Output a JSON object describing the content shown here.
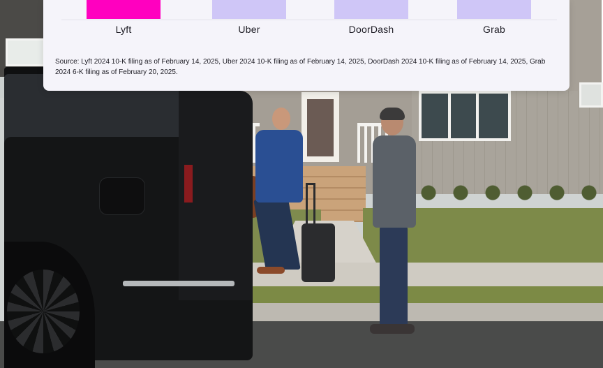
{
  "chart": {
    "categories": [
      {
        "label": "Lyft",
        "color": "#ff00bf"
      },
      {
        "label": "Uber",
        "color": "#cfc6f7"
      },
      {
        "label": "DoorDash",
        "color": "#cfc6f7"
      },
      {
        "label": "Grab",
        "color": "#cfc6f7"
      }
    ]
  },
  "source_note": "Source: Lyft 2024 10-K filing as of February 14, 2025, Uber 2024 10-K filing as of February 14, 2025, DoorDash 2024 10-K filing as of February 14, 2025, Grab 2024 6-K filing as of February 20, 2025."
}
